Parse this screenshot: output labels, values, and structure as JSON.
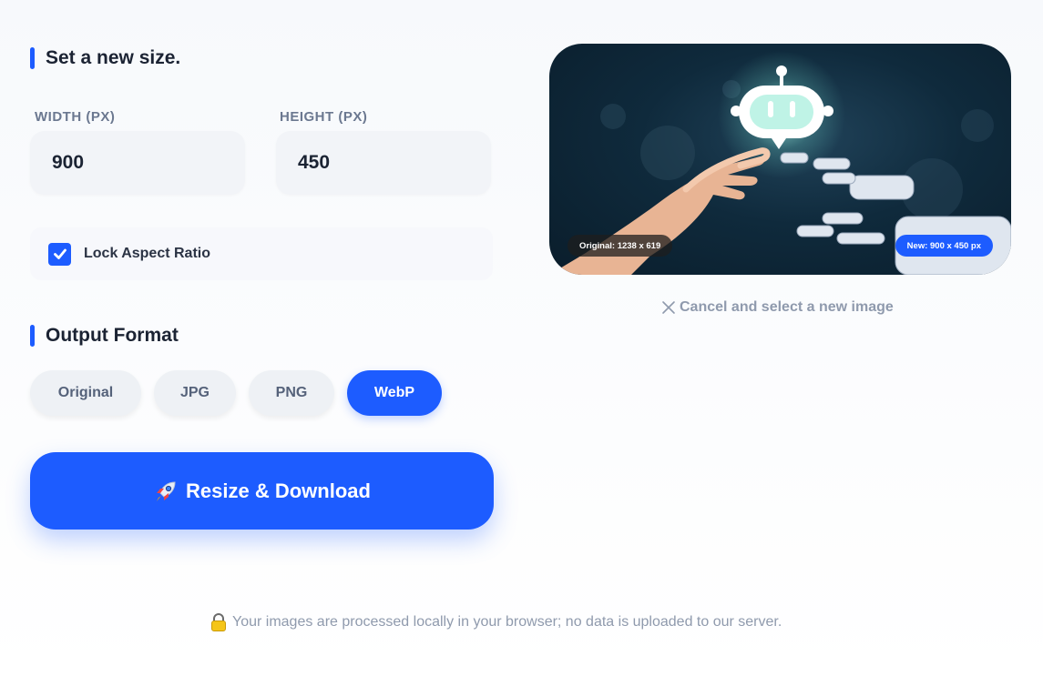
{
  "size_section": {
    "title": "Set a new size."
  },
  "width": {
    "label": "WIDTH (PX)",
    "value": "900"
  },
  "height": {
    "label": "HEIGHT (PX)",
    "value": "450"
  },
  "lock": {
    "label": "Lock Aspect Ratio",
    "checked": true
  },
  "format_section": {
    "title": "Output Format",
    "options": [
      "Original",
      "JPG",
      "PNG",
      "WebP"
    ],
    "selected": "WebP"
  },
  "cta": {
    "label": "Resize & Download",
    "icon": "rocket-icon"
  },
  "preview": {
    "original_badge": "Original: 1238 x 619",
    "new_badge": "New: 900 x 450 px"
  },
  "cancel": {
    "label": "Cancel and select a new image"
  },
  "footer": {
    "note": "Your images are processed locally in your browser; no data is uploaded to our server."
  },
  "colors": {
    "accent": "#1d5cff",
    "muted_text": "#8f9aad"
  }
}
